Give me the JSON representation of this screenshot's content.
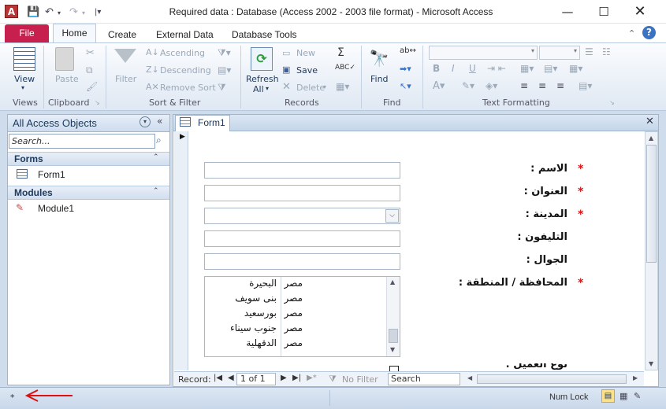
{
  "titlebar": {
    "title": "Required data : Database (Access 2002 - 2003 file format)  -  Microsoft Access",
    "app_icon": "A"
  },
  "tabs": {
    "file": "File",
    "home": "Home",
    "create": "Create",
    "external": "External Data",
    "dbtools": "Database Tools"
  },
  "ribbon": {
    "views": {
      "view": "View",
      "label": "Views"
    },
    "clipboard": {
      "paste": "Paste",
      "label": "Clipboard"
    },
    "sortfilter": {
      "filter": "Filter",
      "ascending": "Ascending",
      "descending": "Descending",
      "remove_sort": "Remove Sort",
      "label": "Sort & Filter"
    },
    "records": {
      "refresh": "Refresh",
      "all": "All",
      "new": "New",
      "save": "Save",
      "delete": "Delete",
      "label": "Records"
    },
    "find": {
      "find": "Find",
      "label": "Find"
    },
    "text": {
      "label": "Text Formatting",
      "bold": "B",
      "italic": "I",
      "underline": "U"
    }
  },
  "nav": {
    "header": "All Access Objects",
    "search_placeholder": "Search...",
    "groups": [
      {
        "title": "Forms",
        "items": [
          "Form1"
        ]
      },
      {
        "title": "Modules",
        "items": [
          "Module1"
        ]
      }
    ]
  },
  "document": {
    "tab_label": "Form1",
    "fields": [
      {
        "label": "الاسم :",
        "required": true
      },
      {
        "label": "العنوان :",
        "required": true
      },
      {
        "label": "المدينة :",
        "required": true
      },
      {
        "label": "التليفون :",
        "required": false
      },
      {
        "label": "الجوال :",
        "required": false
      },
      {
        "label": "المحافظة / المنطقة :",
        "required": true
      }
    ],
    "list_rows": [
      {
        "country": "مصر",
        "gov": "البحيرة"
      },
      {
        "country": "مصر",
        "gov": "بنى سويف"
      },
      {
        "country": "مصر",
        "gov": "بورسعيد"
      },
      {
        "country": "مصر",
        "gov": "جنوب سيناء"
      },
      {
        "country": "مصر",
        "gov": "الدقهلية"
      }
    ],
    "partial_label": "نوع العميل :"
  },
  "record_nav": {
    "label": "Record:",
    "position": "1 of 1",
    "no_filter": "No Filter",
    "search": "Search"
  },
  "statusbar": {
    "left": "*",
    "numlock": "Num Lock"
  },
  "colors": {
    "file_tab": "#c8204e",
    "required_star": "#dd1111",
    "arrow": "#dd1111"
  }
}
